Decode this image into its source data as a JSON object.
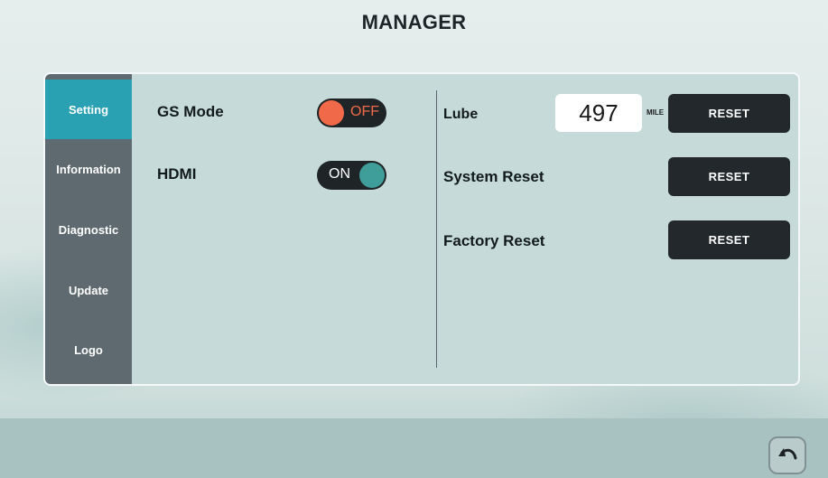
{
  "title": "MANAGER",
  "sidebar": {
    "items": [
      {
        "label": "Setting"
      },
      {
        "label": "Information"
      },
      {
        "label": "Diagnostic"
      },
      {
        "label": "Update"
      },
      {
        "label": "Logo"
      }
    ]
  },
  "settings": {
    "gs_mode": {
      "label": "GS Mode",
      "state": "OFF"
    },
    "hdmi": {
      "label": "HDMI",
      "state": "ON"
    }
  },
  "maintenance": {
    "lube": {
      "label": "Lube",
      "value": "497",
      "unit": "MILE",
      "button": "RESET"
    },
    "system_reset": {
      "label": "System Reset",
      "button": "RESET"
    },
    "factory_reset": {
      "label": "Factory Reset",
      "button": "RESET"
    }
  },
  "colors": {
    "accent": "#2aa1b3",
    "toggle_off": "#f06a4a",
    "toggle_on": "#3f9d9a",
    "button": "#22282c"
  },
  "icons": {
    "back": "undo-arrow-icon"
  }
}
